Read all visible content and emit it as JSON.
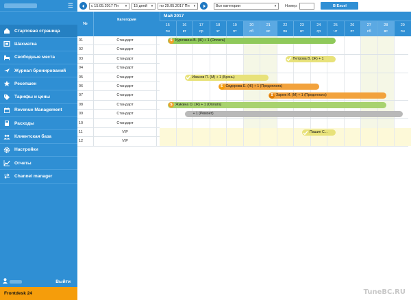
{
  "sidebar": {
    "items": [
      {
        "label": "Стартовая страница",
        "icon": "home-icon"
      },
      {
        "label": "Шахматка",
        "icon": "grid-icon"
      },
      {
        "label": "Свободные места",
        "icon": "bed-icon"
      },
      {
        "label": "Журнал бронирований",
        "icon": "plane-icon"
      },
      {
        "label": "Ресепшен",
        "icon": "star-icon"
      },
      {
        "label": "Тарифы и цены",
        "icon": "tag-icon"
      },
      {
        "label": "Revenue Management",
        "icon": "calendar-icon"
      },
      {
        "label": "Расходы",
        "icon": "calculator-icon"
      },
      {
        "label": "Клиентская база",
        "icon": "group-icon"
      },
      {
        "label": "Настройки",
        "icon": "gear-icon"
      },
      {
        "label": "Отчеты",
        "icon": "chart-icon"
      },
      {
        "label": "Channel manager",
        "icon": "exchange-icon"
      }
    ],
    "logout_label": "Выйти",
    "brand": "Frontdesk 24"
  },
  "toolbar": {
    "date_from": "с 15.05.2017 Пн",
    "period": "15 дней",
    "date_to": "по 29.05.2017 Пн",
    "category": "Все категории",
    "number_label": "Номер:",
    "number_value": "",
    "excel_label": "В Excel"
  },
  "grid": {
    "num_header": "№",
    "category_header": "Категория",
    "month": "Май 2017",
    "days": [
      {
        "d": "15",
        "w": "пн"
      },
      {
        "d": "16",
        "w": "вт"
      },
      {
        "d": "17",
        "w": "ср"
      },
      {
        "d": "18",
        "w": "чт"
      },
      {
        "d": "19",
        "w": "пт"
      },
      {
        "d": "20",
        "w": "сб"
      },
      {
        "d": "21",
        "w": "вс"
      },
      {
        "d": "22",
        "w": "пн"
      },
      {
        "d": "23",
        "w": "вт"
      },
      {
        "d": "24",
        "w": "ср"
      },
      {
        "d": "25",
        "w": "чт"
      },
      {
        "d": "26",
        "w": "пт"
      },
      {
        "d": "27",
        "w": "сб"
      },
      {
        "d": "28",
        "w": "вс"
      },
      {
        "d": "29",
        "w": "пн"
      }
    ],
    "rows": [
      {
        "num": "01",
        "cat": "Стандарт"
      },
      {
        "num": "02",
        "cat": "Стандарт"
      },
      {
        "num": "03",
        "cat": "Стандарт"
      },
      {
        "num": "04",
        "cat": "Стандарт"
      },
      {
        "num": "05",
        "cat": "Стандарт"
      },
      {
        "num": "06",
        "cat": "Стандарт"
      },
      {
        "num": "07",
        "cat": "Стандарт"
      },
      {
        "num": "08",
        "cat": "Стандарт"
      },
      {
        "num": "09",
        "cat": "Стандарт"
      },
      {
        "num": "10",
        "cat": "Стандарт"
      },
      {
        "num": "11",
        "cat": "VIP"
      },
      {
        "num": "12",
        "cat": "VIP"
      }
    ],
    "bookings": [
      {
        "row": 0,
        "start": 0,
        "end": 10,
        "label": "Курочкина В. (Ж) + 1 (Оплата)",
        "color": "#8fc95a",
        "icon": "dollar-icon",
        "icon_color": "#f0a02a"
      },
      {
        "row": 2,
        "start": 7,
        "end": 10,
        "label": "Петрова В. (Ж) + 1",
        "color": "#e8e27a",
        "icon": "check-icon",
        "icon_color": "#d4c948"
      },
      {
        "row": 4,
        "start": 1,
        "end": 6,
        "label": "Иванов П. (М) + 1 (Бронь)",
        "color": "#e8e27a",
        "icon": "check-icon",
        "icon_color": "#d4c948"
      },
      {
        "row": 5,
        "start": 3,
        "end": 9,
        "label": "Сидорова Е. (Ж) + 1 (Предоплата)",
        "color": "#f2a23c",
        "icon": "dollar-icon",
        "icon_color": "#f59d0b"
      },
      {
        "row": 6,
        "start": 6,
        "end": 13,
        "label": "Зарюк И. (М) + 1 (Предоплата)",
        "color": "#f2a23c",
        "icon": "dollar-icon",
        "icon_color": "#e07b00"
      },
      {
        "row": 7,
        "start": 0,
        "end": 13,
        "label": "Жмкина О. (Ж) + 1 (Оплата)",
        "color": "#a8d26e",
        "icon": "dollar-icon",
        "icon_color": "#f0a02a"
      },
      {
        "row": 8,
        "start": 1,
        "end": 14,
        "label": "+ 1 (Ремонт)",
        "color": "#b9b9b9",
        "icon": "",
        "icon_color": ""
      },
      {
        "row": 10,
        "start": 8,
        "end": 10,
        "label": "Пашин С...",
        "color": "#e8e27a",
        "icon": "check-icon",
        "icon_color": "#d4c948"
      }
    ]
  },
  "watermark": "TuneBC.RU"
}
